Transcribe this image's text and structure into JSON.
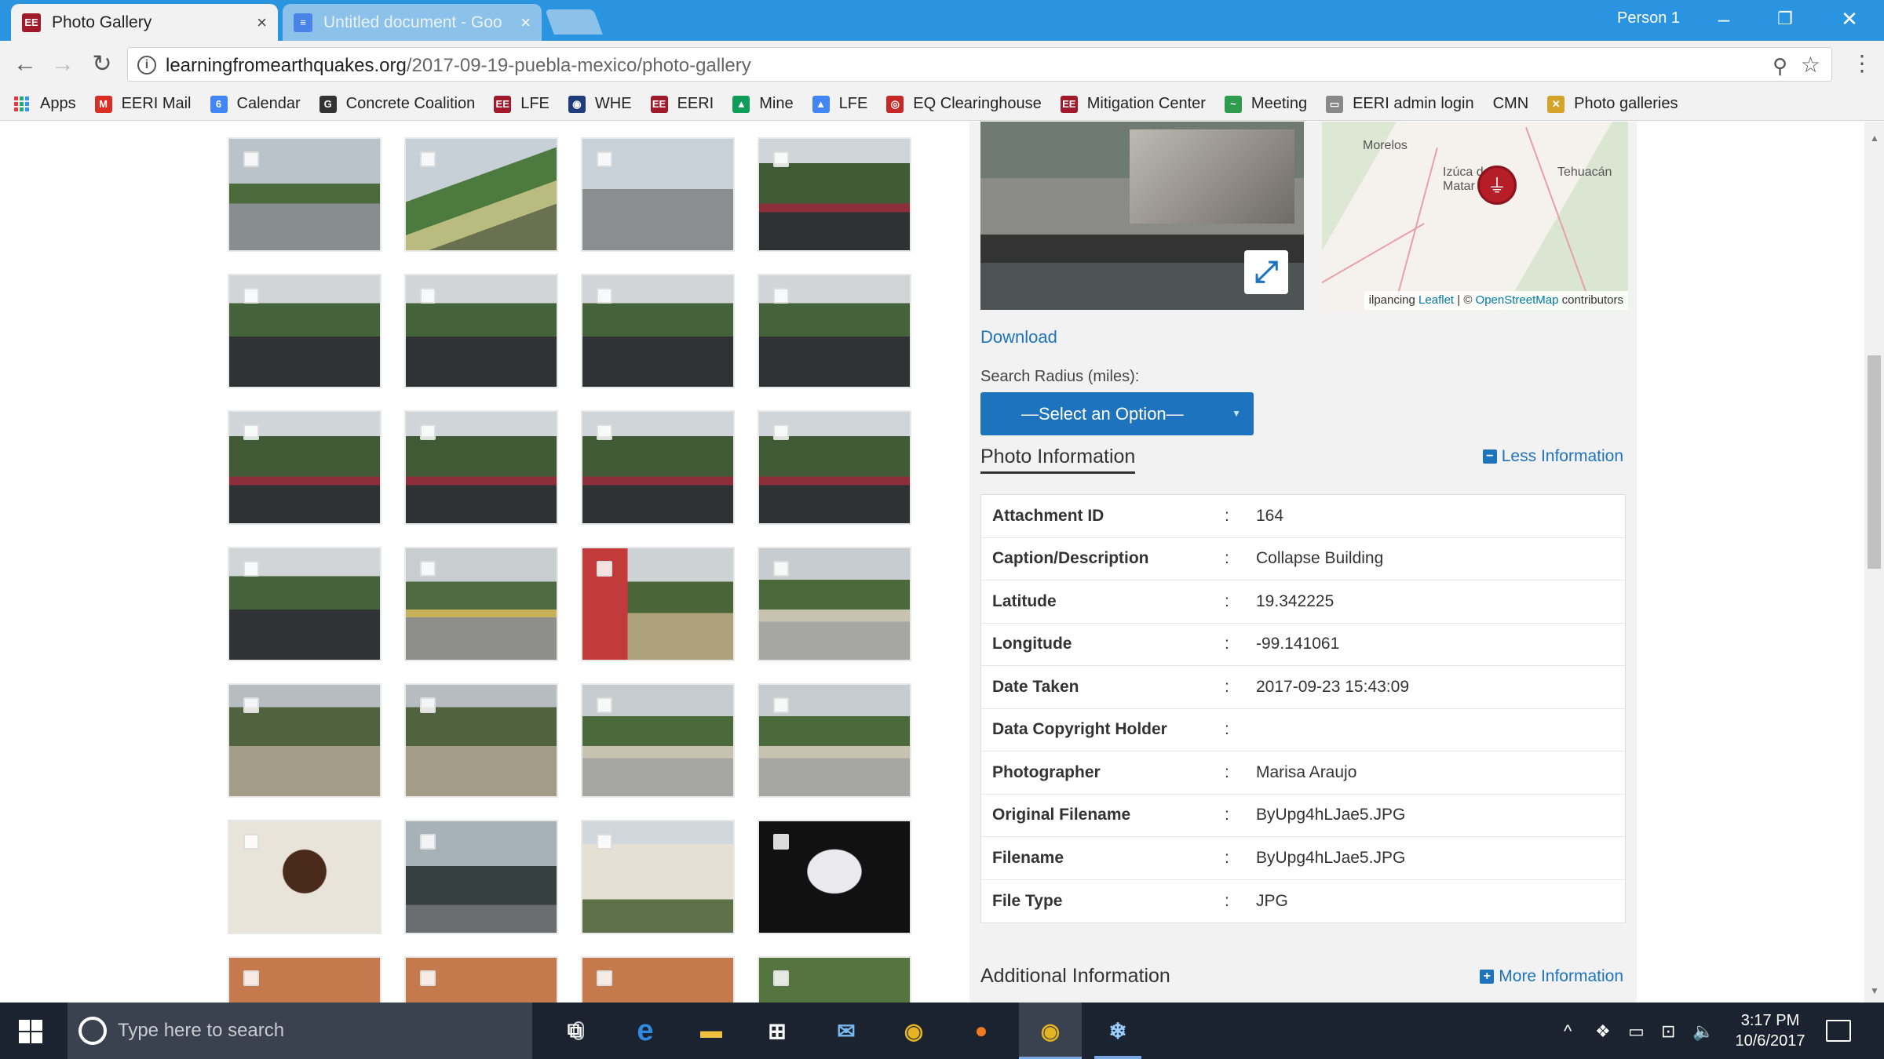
{
  "browser": {
    "tabs": [
      {
        "title": "Photo Gallery",
        "active": true
      },
      {
        "title": "Untitled document - Goo",
        "active": false
      }
    ],
    "profile": "Person 1",
    "url_domain": "learningfromearthquakes.org",
    "url_path": "/2017-09-19-puebla-mexico/photo-gallery",
    "bookmarks": [
      {
        "label": "Apps",
        "icon": "apps-grid-icon"
      },
      {
        "label": "EERI Mail",
        "icon": "gmail-icon",
        "icon_text": "M",
        "color": "#d93025"
      },
      {
        "label": "Calendar",
        "icon": "calendar-icon",
        "icon_text": "6",
        "color": "#4285f4"
      },
      {
        "label": "Concrete Coalition",
        "icon": "concrete-coalition-icon",
        "icon_text": "G",
        "color": "#333333"
      },
      {
        "label": "LFE",
        "icon": "lfe-icon",
        "icon_text": "EE",
        "color": "#a01a2c"
      },
      {
        "label": "WHE",
        "icon": "whe-icon",
        "icon_text": "◉",
        "color": "#1f3d7a"
      },
      {
        "label": "EERI",
        "icon": "eeri-icon",
        "icon_text": "EE",
        "color": "#a01a2c"
      },
      {
        "label": "Mine",
        "icon": "drive-icon",
        "icon_text": "▲",
        "color": "#0f9d58"
      },
      {
        "label": "LFE",
        "icon": "drive-icon",
        "icon_text": "▲",
        "color": "#4285f4"
      },
      {
        "label": "EQ Clearinghouse",
        "icon": "eq-clearinghouse-icon",
        "icon_text": "◎",
        "color": "#c62828"
      },
      {
        "label": "Mitigation Center",
        "icon": "mitigation-center-icon",
        "icon_text": "EE",
        "color": "#a01a2c"
      },
      {
        "label": "Meeting",
        "icon": "meeting-icon",
        "icon_text": "~",
        "color": "#2e9b4f"
      },
      {
        "label": "EERI admin login",
        "icon": "page-icon",
        "icon_text": "▭",
        "color": "#888888"
      },
      {
        "label": "CMN",
        "icon": "",
        "icon_text": "",
        "color": ""
      },
      {
        "label": "Photo galleries",
        "icon": "photo-galleries-icon",
        "icon_text": "✕",
        "color": "#d4a32a"
      }
    ]
  },
  "gallery": {
    "thumbnails": [
      "t-road",
      "t-rail",
      "t-bridge",
      "t-trees",
      "t-trees2",
      "t-trees2",
      "t-trees2",
      "t-trees2",
      "t-trees",
      "t-trees",
      "t-trees",
      "t-trees",
      "t-trees2",
      "t-plaza",
      "t-flag",
      "t-lot",
      "t-lot2",
      "t-lot2",
      "t-lot",
      "t-lot",
      "t-window",
      "t-street",
      "t-apt",
      "t-board",
      "t-brick",
      "t-brick",
      "t-brick",
      "t-brick2"
    ]
  },
  "panel": {
    "download_label": "Download",
    "search_radius_label": "Search Radius (miles):",
    "select_value": "—Select an Option—",
    "map": {
      "labels": [
        "Morelos",
        "Izúca de Matar",
        "Tehuacán",
        "ilpancing"
      ],
      "attribution_link": "Leaflet",
      "attribution_sep": " | © ",
      "attribution_osm": "OpenStreetMap",
      "attribution_suffix": " contributors"
    },
    "photo_info_title": "Photo Information",
    "less_info_label": "Less Information",
    "rows": [
      {
        "key": "Attachment ID",
        "value": "164"
      },
      {
        "key": "Caption/Description",
        "value": "Collapse Building"
      },
      {
        "key": "Latitude",
        "value": "19.342225"
      },
      {
        "key": "Longitude",
        "value": "-99.141061"
      },
      {
        "key": "Date Taken",
        "value": "2017-09-23 15:43:09"
      },
      {
        "key": "Data Copyright Holder",
        "value": ""
      },
      {
        "key": "Photographer",
        "value": "Marisa Araujo"
      },
      {
        "key": "Original Filename",
        "value": "ByUpg4hLJae5.JPG"
      },
      {
        "key": "Filename",
        "value": "ByUpg4hLJae5.JPG"
      },
      {
        "key": "File Type",
        "value": "JPG"
      }
    ],
    "additional_title": "Additional Information",
    "more_info_label": "More Information"
  },
  "taskbar": {
    "search_placeholder": "Type here to search",
    "time": "3:17 PM",
    "date": "10/6/2017"
  }
}
